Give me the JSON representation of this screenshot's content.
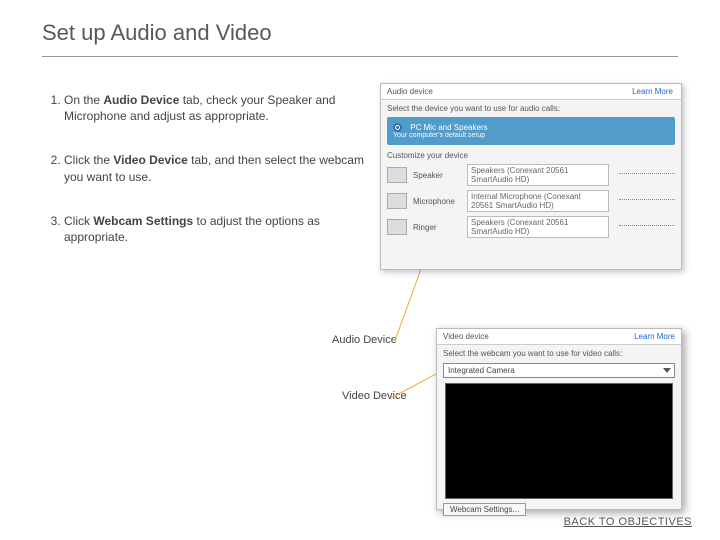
{
  "title": "Set up Audio and Video",
  "steps": {
    "s1_pre": "On the ",
    "s1_b": "Audio Device",
    "s1_post": " tab, check your Speaker and Microphone and adjust as appropriate.",
    "s2_pre": "Click the ",
    "s2_b": "Video Device",
    "s2_post": " tab, and then select the webcam you want to use.",
    "s3_pre": "Click ",
    "s3_b": "Webcam Settings",
    "s3_post": " to adjust the options as appropriate."
  },
  "callouts": {
    "audio": "Audio Device",
    "video": "Video Device"
  },
  "audio_panel": {
    "header": "Audio device",
    "instruction": "Select the device you want to use for audio calls:",
    "learn_more": "Learn More",
    "selected_option": "PC Mic and Speakers",
    "selected_sub": "Your computer's default setup",
    "customize": "Customize your device",
    "rows": {
      "speaker": {
        "label": "Speaker",
        "value": "Speakers (Conexant 20561 SmartAudio HD)"
      },
      "microphone": {
        "label": "Microphone",
        "value": "Internal Microphone (Conexant 20561 SmartAudio HD)"
      },
      "ringer": {
        "label": "Ringer",
        "value": "Speakers (Conexant 20561 SmartAudio HD)"
      }
    }
  },
  "video_panel": {
    "header": "Video device",
    "instruction": "Select the webcam you want to use for video calls:",
    "learn_more": "Learn More",
    "selected_camera": "Integrated Camera",
    "webcam_settings_btn": "Webcam Settings..."
  },
  "back_link": "BACK TO OBJECTIVES"
}
